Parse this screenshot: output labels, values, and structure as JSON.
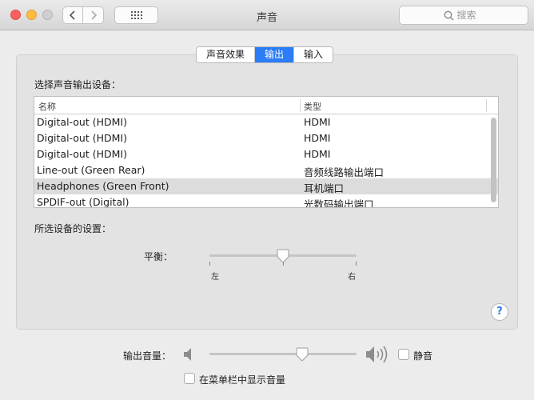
{
  "window": {
    "title": "声音"
  },
  "search": {
    "placeholder": "搜索"
  },
  "tabs": [
    {
      "label": "声音效果",
      "active": false
    },
    {
      "label": "输出",
      "active": true
    },
    {
      "label": "输入",
      "active": false
    }
  ],
  "output": {
    "select_label": "选择声音输出设备：",
    "columns": [
      "名称",
      "类型"
    ],
    "devices": [
      {
        "name": "Digital-out (HDMI)",
        "type": "HDMI"
      },
      {
        "name": "Digital-out (HDMI)",
        "type": "HDMI"
      },
      {
        "name": "Digital-out (HDMI)",
        "type": "HDMI"
      },
      {
        "name": "Line-out (Green Rear)",
        "type": "音频线路输出端口"
      },
      {
        "name": "Headphones (Green Front)",
        "type": "耳机端口"
      },
      {
        "name": "SPDIF-out (Digital)",
        "type": "光数码输出端口"
      }
    ],
    "selected_index": 4,
    "settings_label": "所选设备的设置：",
    "balance": {
      "label": "平衡：",
      "left": "左",
      "right": "右",
      "value": 0.5
    }
  },
  "volume": {
    "label": "输出音量：",
    "value": 0.63,
    "mute_label": "静音",
    "muted": false
  },
  "menubar": {
    "label": "在菜单栏中显示音量",
    "checked": false
  },
  "colors": {
    "accent": "#2b7cf6",
    "close": "#fc605c",
    "minimize": "#fdbc40",
    "zoom": "#cfcfcf"
  }
}
